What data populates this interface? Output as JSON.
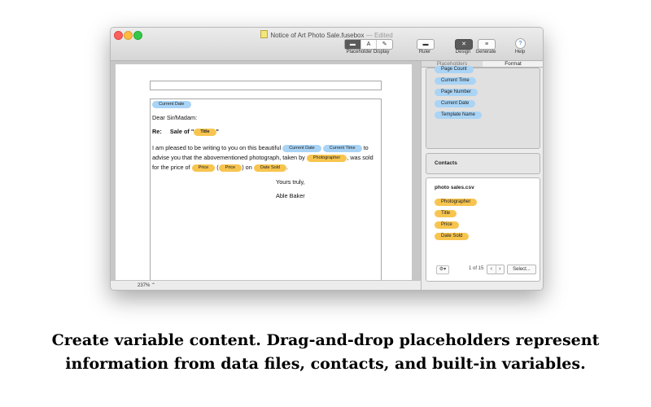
{
  "window": {
    "title": "Notice of Art Photo Sale.fusebox",
    "status": "— Edited"
  },
  "toolbar": {
    "placeholder_display_label": "Placeholder Display",
    "placeholder_display_segments": [
      "▬",
      "A",
      "✎"
    ],
    "ruler_label": "Ruler",
    "design_label": "Design",
    "generate_label": "Generate",
    "help_label": "Help",
    "help_glyph": "?"
  },
  "document": {
    "date_placeholder": "Current Date",
    "salutation": "Dear Sir/Madam:",
    "re_label": "Re:",
    "sale_of": "Sale of \"",
    "title_placeholder": "Title",
    "close_quote": "\"",
    "para_line1_text": "I am pleased to be writing to you on this beautiful",
    "para_line1_tail": "to",
    "current_date": "Current Date",
    "current_time": "Current Time",
    "para_line2_text": "advise you that the abovementioned photograph, taken by",
    "photographer": "Photographer",
    "para_line2_tail": ", was sold",
    "para_line3_text": "for the price of",
    "price": "Price",
    "open_paren": "(",
    "close_paren": ") on",
    "date_sold": "Date Sold",
    "period": ".",
    "closing": "Yours truly,",
    "signature": "Able Baker"
  },
  "statusbar": {
    "zoom": "237% ⌃"
  },
  "right_pane": {
    "tabs": [
      "Placeholders",
      "Format"
    ],
    "builtin_variables": [
      "Page Count",
      "Current Time",
      "Page Number",
      "Current Date",
      "Template Name"
    ],
    "contacts_label": "Contacts",
    "datafile_name": "photo sales.csv",
    "datafile_fields": [
      "Photographer",
      "Title",
      "Price",
      "Date Sold"
    ],
    "gear": "⚙▾",
    "record_count": "1 of 15",
    "prev": "‹",
    "next": "›",
    "select_button": "Select..."
  },
  "caption": {
    "line1": "Create variable content. Drag-and-drop placeholders represent",
    "line2": "information from data files, contacts, and built-in variables."
  },
  "colors": {
    "builtin_pill": "#a9d4f6",
    "datafield_pill": "#f7c54f"
  }
}
